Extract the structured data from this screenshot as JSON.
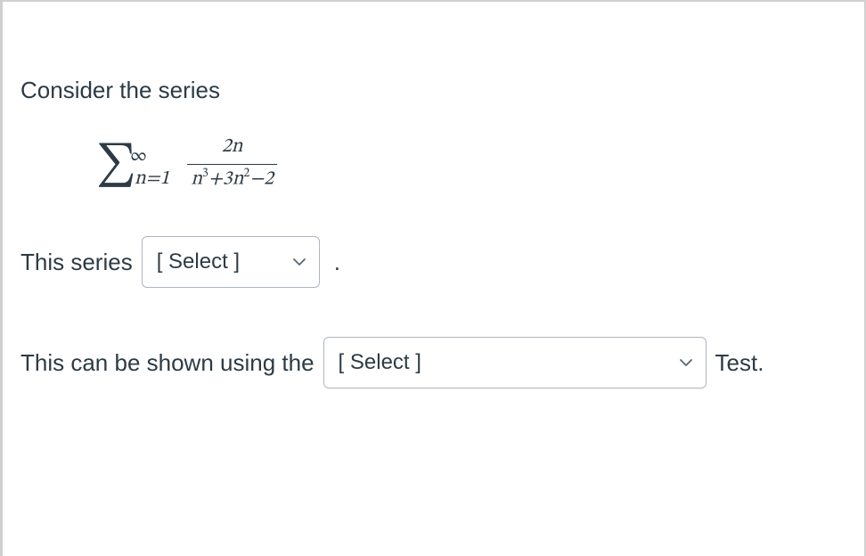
{
  "intro_text": "Consider the series",
  "math": {
    "sigma_upper": "∞",
    "sigma_lower": "n=1",
    "frac_num": "2n",
    "frac_den_html": "n³+3n²−2"
  },
  "row1": {
    "prefix": "This series",
    "select_placeholder": "[ Select ]",
    "suffix": "."
  },
  "row2": {
    "prefix": "This can be shown using the",
    "select_placeholder": "[ Select ]",
    "suffix": " Test."
  }
}
